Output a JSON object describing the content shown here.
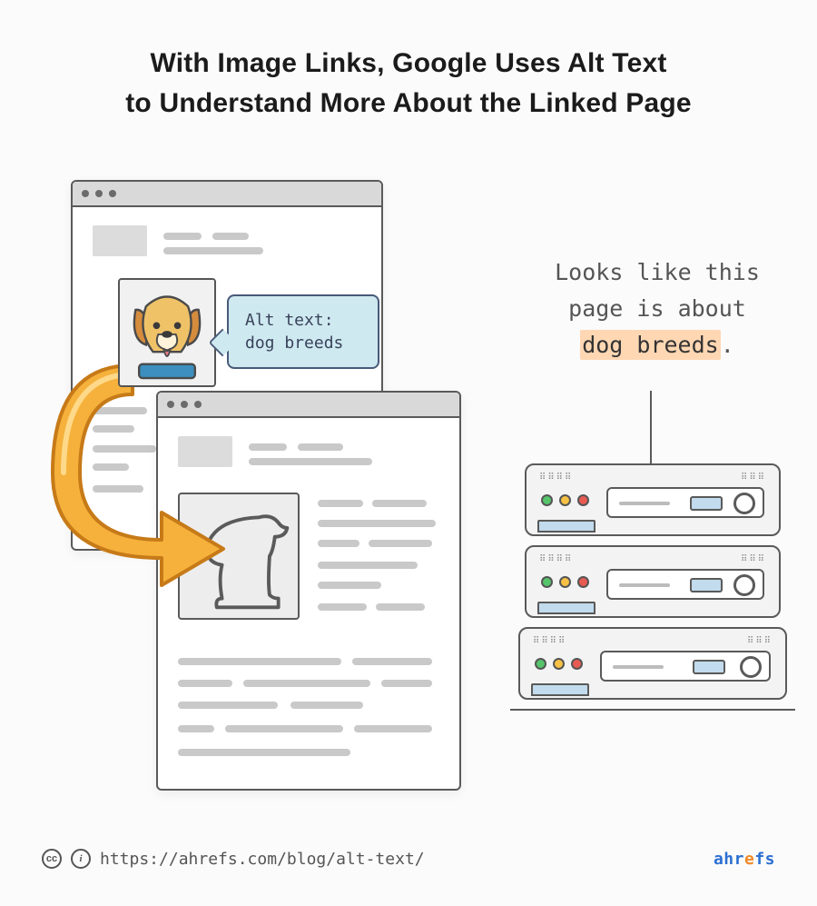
{
  "title_line1": "With Image Links, Google Uses Alt Text",
  "title_line2": "to Understand More About the Linked Page",
  "speech": {
    "line1": "Alt text:",
    "line2": "dog breeds"
  },
  "server_text": {
    "line1": "Looks like this",
    "line2": "page is about",
    "highlight": "dog breeds",
    "period": "."
  },
  "footer": {
    "url": "https://ahrefs.com/blog/alt-text/",
    "cc_label": "cc",
    "by_label": "i",
    "brand": "ahrefs"
  },
  "icons": {
    "dog_photo": "dog-face",
    "dog_outline": "dog-silhouette",
    "arrow": "curved-arrow",
    "server": "server-rack"
  }
}
